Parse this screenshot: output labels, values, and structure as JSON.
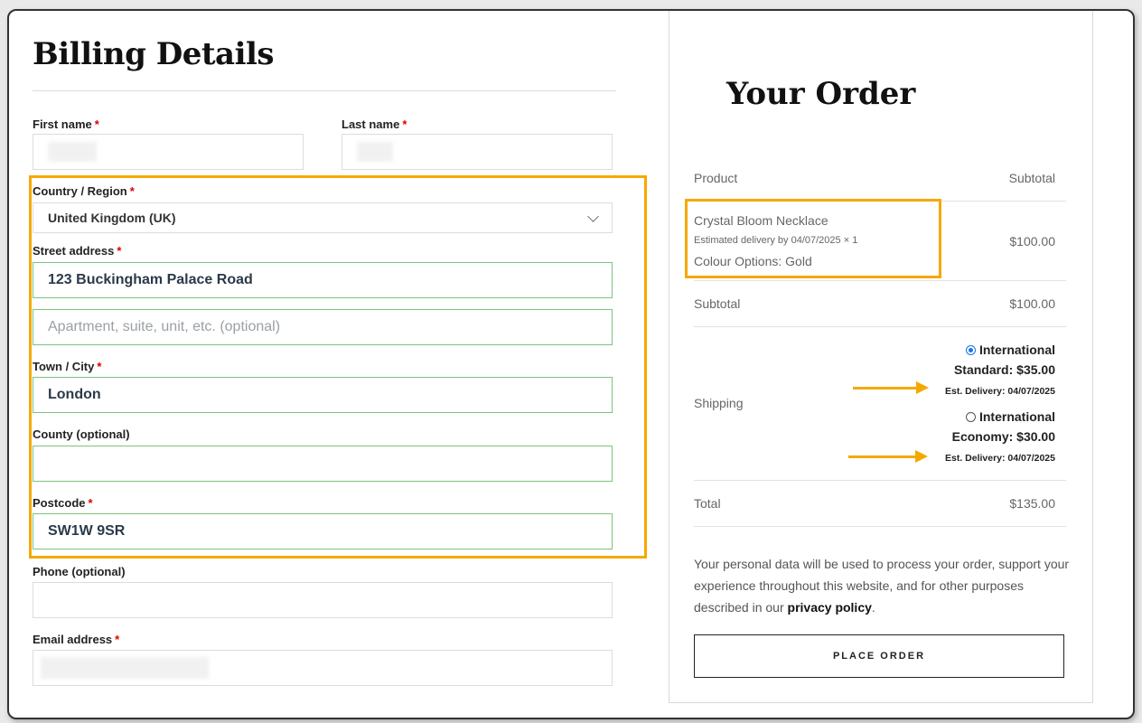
{
  "billing": {
    "title": "Billing Details",
    "first_name_label": "First name",
    "last_name_label": "Last name",
    "country_label": "Country / Region",
    "country_value": "United Kingdom (UK)",
    "street_label": "Street address",
    "street_value": "123 Buckingham Palace Road",
    "street2_placeholder": "Apartment, suite, unit, etc. (optional)",
    "town_label": "Town / City",
    "town_value": "London",
    "county_label": "County (optional)",
    "postcode_label": "Postcode",
    "postcode_value": "SW1W 9SR",
    "phone_label": "Phone (optional)",
    "email_label": "Email address",
    "required_mark": "*"
  },
  "order": {
    "title": "Your Order",
    "col_product": "Product",
    "col_subtotal": "Subtotal",
    "item_name": "Crystal Bloom Necklace",
    "item_delivery": "Estimated delivery by 04/07/2025",
    "item_qty": "× 1",
    "item_colour": "Colour Options: Gold",
    "item_price": "$100.00",
    "subtotal_label": "Subtotal",
    "subtotal_value": "$100.00",
    "shipping_label": "Shipping",
    "ship1_line1": "International",
    "ship1_line2": "Standard: $35.00",
    "ship1_est": "Est. Delivery: 04/07/2025",
    "ship2_line1": "International",
    "ship2_line2": "Economy: $30.00",
    "ship2_est": "Est. Delivery: 04/07/2025",
    "total_label": "Total",
    "total_value": "$135.00",
    "privacy_text": "Your personal data will be used to process your order, support your experience throughout this website, and for other purposes described in our ",
    "privacy_link": "privacy policy",
    "privacy_end": ".",
    "place_order": "PLACE ORDER"
  },
  "colors": {
    "highlight": "#f5a800",
    "valid_border": "#7cc47c",
    "required": "#dd0000",
    "radio_accent": "#1a73e8"
  }
}
